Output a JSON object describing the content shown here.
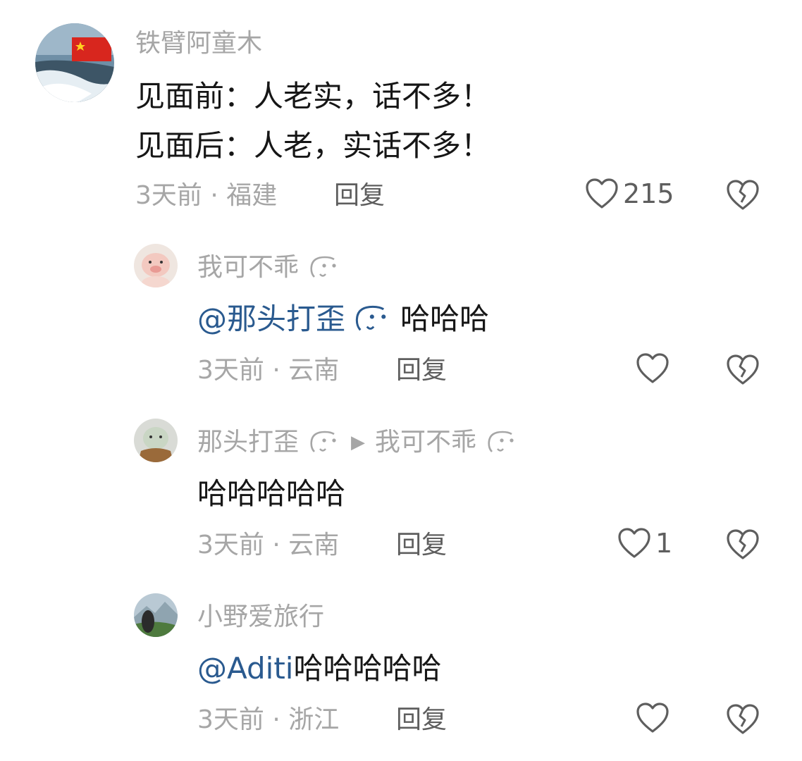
{
  "colors": {
    "muted": "#a6a6a6",
    "text": "#161616",
    "mention": "#2a5a8f",
    "action": "#5e5e5e"
  },
  "comments": [
    {
      "user": "铁臂阿童木",
      "lines": [
        "见面前：人老实，话不多！",
        "见面后：人老，实话不多！"
      ],
      "time": "3天前",
      "location": "福建",
      "reply_label": "回复",
      "likes": "215"
    },
    {
      "user": "我可不乖",
      "mention": "@那头打歪",
      "text": "哈哈哈",
      "time": "3天前",
      "location": "云南",
      "reply_label": "回复",
      "likes": ""
    },
    {
      "user": "那头打歪",
      "reply_to": "我可不乖",
      "text": "哈哈哈哈哈",
      "time": "3天前",
      "location": "云南",
      "reply_label": "回复",
      "likes": "1"
    },
    {
      "user": "小野爱旅行",
      "mention": "@Aditi",
      "text": "哈哈哈哈哈",
      "time": "3天前",
      "location": "浙江",
      "reply_label": "回复",
      "likes": ""
    }
  ]
}
